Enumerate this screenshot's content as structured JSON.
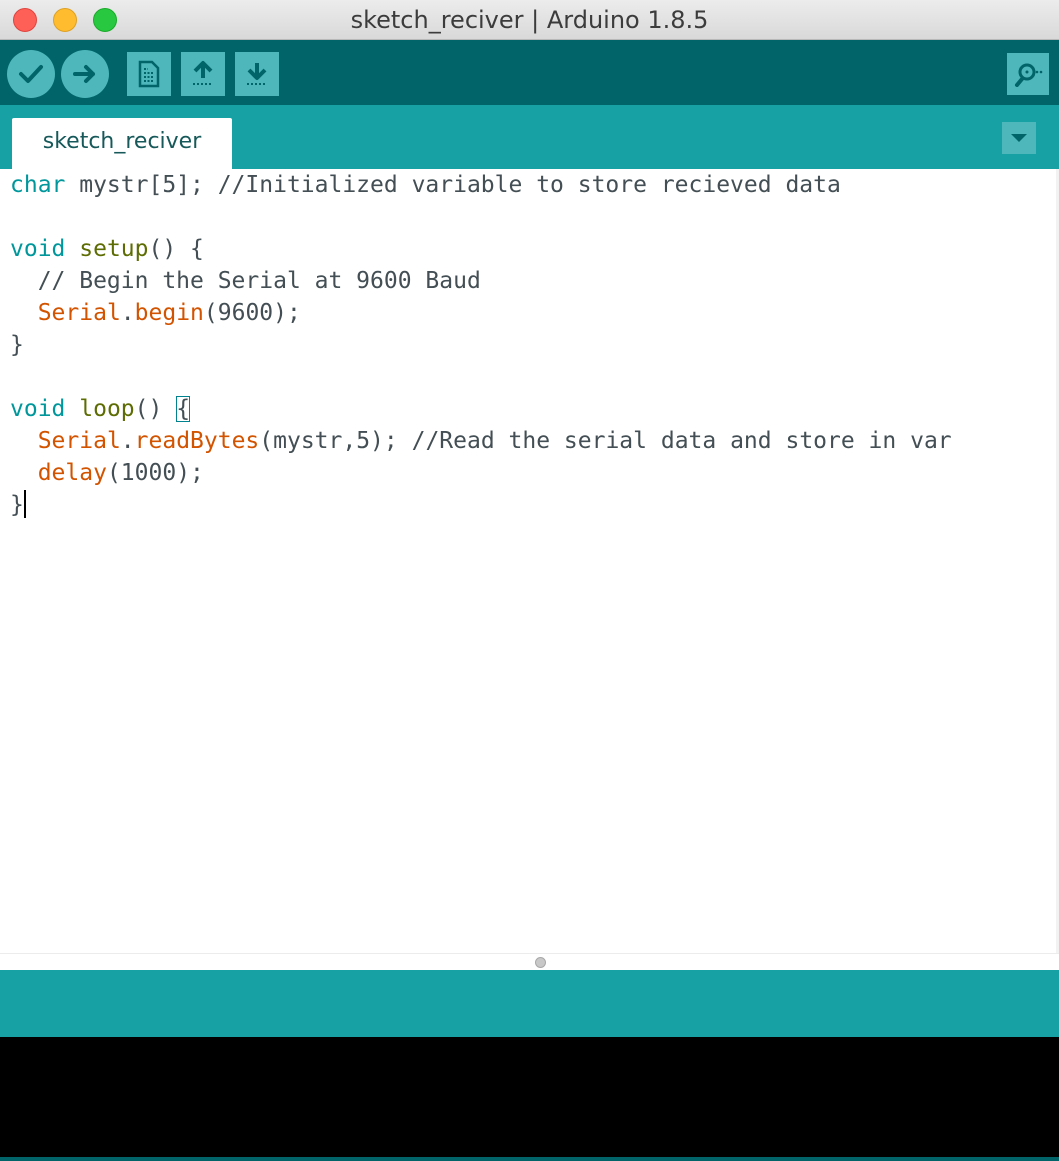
{
  "window": {
    "title": "sketch_reciver | Arduino 1.8.5"
  },
  "toolbar": {
    "buttons": [
      {
        "name": "verify",
        "icon": "checkmark-icon"
      },
      {
        "name": "upload",
        "icon": "arrow-right-icon"
      },
      {
        "name": "new",
        "icon": "new-document-icon"
      },
      {
        "name": "open",
        "icon": "arrow-up-icon"
      },
      {
        "name": "save",
        "icon": "arrow-down-icon"
      },
      {
        "name": "serial-monitor",
        "icon": "magnifier-icon"
      }
    ]
  },
  "tabs": [
    {
      "label": "sketch_reciver",
      "active": true
    }
  ],
  "editor": {
    "lines": [
      [
        {
          "t": "char",
          "c": "kw"
        },
        {
          "t": " mystr[5]; //Initialized variable to store recieved data",
          "c": "plain"
        }
      ],
      [],
      [
        {
          "t": "void",
          "c": "kw"
        },
        {
          "t": " ",
          "c": "plain"
        },
        {
          "t": "setup",
          "c": "fn"
        },
        {
          "t": "() {",
          "c": "plain"
        }
      ],
      [
        {
          "t": "  // Begin the Serial at 9600 Baud",
          "c": "cm"
        }
      ],
      [
        {
          "t": "  ",
          "c": "plain"
        },
        {
          "t": "Serial",
          "c": "lib"
        },
        {
          "t": ".",
          "c": "plain"
        },
        {
          "t": "begin",
          "c": "lib"
        },
        {
          "t": "(9600);",
          "c": "plain"
        }
      ],
      [
        {
          "t": "}",
          "c": "plain"
        }
      ],
      [],
      [
        {
          "t": "void",
          "c": "kw"
        },
        {
          "t": " ",
          "c": "plain"
        },
        {
          "t": "loop",
          "c": "fn"
        },
        {
          "t": "() ",
          "c": "plain"
        },
        {
          "t": "{",
          "c": "plain",
          "hl": true
        }
      ],
      [
        {
          "t": "  ",
          "c": "plain"
        },
        {
          "t": "Serial",
          "c": "lib"
        },
        {
          "t": ".",
          "c": "plain"
        },
        {
          "t": "readBytes",
          "c": "lib"
        },
        {
          "t": "(mystr,5); //Read the serial data and store in var",
          "c": "plain"
        }
      ],
      [
        {
          "t": "  ",
          "c": "plain"
        },
        {
          "t": "delay",
          "c": "lib"
        },
        {
          "t": "(1000);",
          "c": "plain"
        }
      ],
      [
        {
          "t": "}",
          "c": "plain",
          "caret": true
        }
      ]
    ]
  },
  "colors": {
    "toolbar": "#006468",
    "tabbar": "#17a1a5",
    "button": "#4db7bb",
    "keyword": "#00979c",
    "function": "#5e6d03",
    "library": "#d35400",
    "text": "#434f54",
    "console": "#000000"
  }
}
